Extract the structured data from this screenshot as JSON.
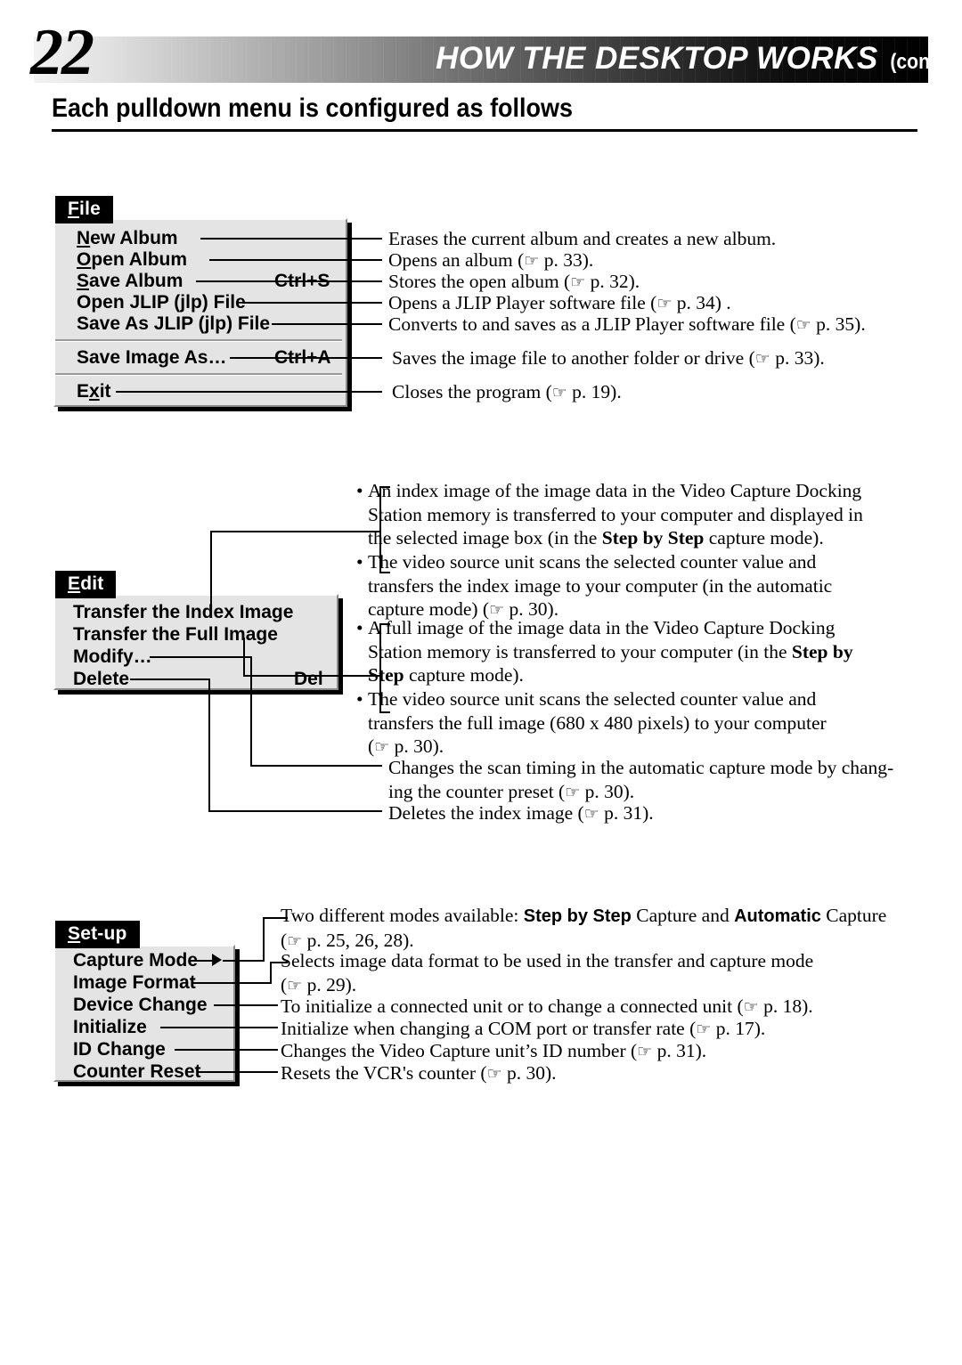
{
  "header": {
    "page_number": "22",
    "title": "HOW THE DESKTOP WORKS",
    "cont": "(cont.)"
  },
  "section": {
    "heading": "Each pulldown menu is configured as follows"
  },
  "hand_icon": "☞",
  "menus": [
    {
      "id": "file",
      "tab_label": "File",
      "tab_underline_char": "F",
      "items": [
        {
          "label": "New Album",
          "accel": "",
          "desc": "Erases the current album and creates a new album."
        },
        {
          "label": "Open Album",
          "accel": "",
          "desc": "Opens an album (☞ p. 33)."
        },
        {
          "label": "Save Album",
          "accel": "Ctrl+S",
          "desc": "Stores the open album (☞ p. 32)."
        },
        {
          "label": "Open JLIP (jlp) File",
          "accel": "",
          "desc": "Opens a JLIP Player software file (☞ p. 34) ."
        },
        {
          "label": "Save As JLIP (jlp) File",
          "accel": "",
          "desc": "Converts to and saves as a JLIP Player software file (☞ p. 35)."
        },
        {
          "label": "Save Image As…",
          "accel": "Ctrl+A",
          "desc": "Saves the image file to another folder or drive (☞ p. 33)."
        },
        {
          "label": "Exit",
          "accel": "",
          "desc": "Closes the program (☞ p. 19)."
        }
      ]
    },
    {
      "id": "edit",
      "tab_label": "Edit",
      "tab_underline_char": "E",
      "items": [
        {
          "label": "Transfer the Index Image",
          "accel": ""
        },
        {
          "label": "Transfer the Full Image",
          "accel": ""
        },
        {
          "label": "Modify…",
          "accel": ""
        },
        {
          "label": "Delete",
          "accel": "Del"
        }
      ]
    },
    {
      "id": "setup",
      "tab_label": "Set-up",
      "tab_underline_char": "S",
      "items": [
        {
          "label": "Capture Mode",
          "submenu": true,
          "desc": "Two different modes available: Step by Step Capture and Automatic Capture (☞ p. 25, 26, 28)."
        },
        {
          "label": "Image Format",
          "submenu": false,
          "desc": "Selects image data format to be used in the transfer and capture mode (☞ p. 29)."
        },
        {
          "label": "Device Change",
          "submenu": false,
          "desc": "To initialize a connected unit or to change a connected unit (☞ p. 18)."
        },
        {
          "label": "Initialize",
          "submenu": false,
          "desc": "Initialize when changing a COM port or transfer rate (☞ p. 17)."
        },
        {
          "label": "ID Change",
          "submenu": false,
          "desc": "Changes the Video Capture unit’s ID number (☞ p. 31)."
        },
        {
          "label": "Counter Reset",
          "submenu": false,
          "desc": "Resets the VCR's counter (☞ p. 30)."
        }
      ]
    }
  ],
  "file_descriptions": {
    "d0": "Erases the current album and creates a new album.",
    "d1_a": "Opens an album (",
    "d1_b": " p. 33).",
    "d2_a": "Stores the open album (",
    "d2_b": " p. 32).",
    "d3_a": "Opens a JLIP Player software file (",
    "d3_b": " p. 34) .",
    "d4_a": "Converts to and saves as a JLIP Player software file (",
    "d4_b": " p. 35).",
    "d5_a": "Saves the image file to another folder or drive (",
    "d5_b": " p. 33).",
    "d6_a": "Closes the program (",
    "d6_b": " p. 19)."
  },
  "edit_descriptions": {
    "b1_l1": "An index image of the image data in the Video Capture Docking",
    "b1_l2": "Station memory is transferred to your computer and displayed in",
    "b1_l3a": "the selected image box (in the ",
    "b1_l3b": "Step by Step",
    "b1_l3c": " capture mode).",
    "b2_l1": "The video source unit scans the selected counter value and",
    "b2_l2": "transfers the index image to your computer (in the automatic",
    "b2_l3a": "capture mode) (",
    "b2_l3b": " p. 30).",
    "b3_l1": "A full image of the image data in the Video Capture Docking",
    "b3_l2a": "Station memory is transferred to your computer (in the ",
    "b3_l2b": "Step by",
    "b3_l3a": "Step",
    "b3_l3b": " capture mode).",
    "b4_l1": "The video source unit scans the selected counter value and",
    "b4_l2": "transfers the full image (680 x 480 pixels) to your computer",
    "b4_l3a": "(",
    "b4_l3b": " p. 30).",
    "d_modify_l1": "Changes the scan timing in the automatic capture mode by chang-",
    "d_modify_l2a": "ing the counter preset (",
    "d_modify_l2b": " p. 30).",
    "d_delete_a": "Deletes the index image (",
    "d_delete_b": " p. 31)."
  },
  "setup_descriptions": {
    "s0_l1a": "Two different modes available: ",
    "s0_l1b": "Step by Step",
    "s0_l1c": " Capture and ",
    "s0_l1d": "Automatic",
    "s0_l1e": " Capture",
    "s0_l2a": "(",
    "s0_l2b": " p. 25, 26, 28).",
    "s1_l1": "Selects image data format to be used in the transfer and capture mode",
    "s1_l2a": "(",
    "s1_l2b": " p. 29).",
    "s2_a": "To initialize a connected unit or to change a connected unit (",
    "s2_b": " p. 18).",
    "s3_a": "Initialize when changing a COM port or transfer rate (",
    "s3_b": " p. 17).",
    "s4_a": "Changes the Video Capture unit’s ID number (",
    "s4_b": " p. 31).",
    "s5_a": "Resets the VCR's counter (",
    "s5_b": " p. 30)."
  },
  "colors": {
    "menu_face": "#e4e4e4",
    "tab_bg": "#000000",
    "tab_fg": "#ffffff",
    "line": "#000000"
  }
}
